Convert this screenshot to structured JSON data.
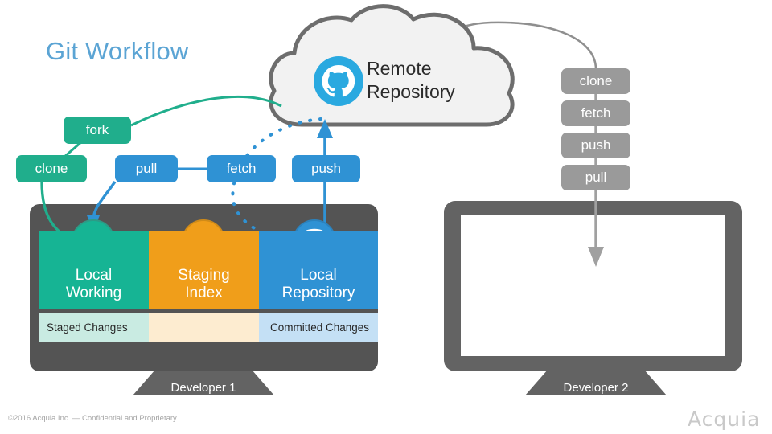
{
  "page": {
    "title": "Git Workflow",
    "footer_text": "©2016 Acquia Inc. — Confidential and Proprietary",
    "logo_text": "Acquia",
    "title_color": "#5ba4d4"
  },
  "cloud": {
    "label_line1": "Remote",
    "label_line2": "Repository",
    "label": "Remote\nRepository",
    "icon": "github-octocat-icon",
    "icon_color": "#2aa9e0",
    "fill": "#f2f2f2",
    "stroke": "#6d6d6d"
  },
  "left_commands": [
    {
      "label": "fork",
      "color": "#20ae8c",
      "style": "green"
    },
    {
      "label": "clone",
      "color": "#20ae8c",
      "style": "green"
    },
    {
      "label": "pull",
      "color": "#2f92d4",
      "style": "blue"
    },
    {
      "label": "fetch",
      "color": "#2f92d4",
      "style": "blue"
    },
    {
      "label": "push",
      "color": "#2f92d4",
      "style": "blue"
    }
  ],
  "right_commands": [
    {
      "label": "clone",
      "color": "#9a9a9a"
    },
    {
      "label": "fetch",
      "color": "#9a9a9a"
    },
    {
      "label": "push",
      "color": "#9a9a9a"
    },
    {
      "label": "pull",
      "color": "#9a9a9a"
    }
  ],
  "developer1": {
    "label": "Developer 1",
    "columns": [
      {
        "line1": "Local",
        "line2": "Working",
        "name": "local-working",
        "color": "#16b494",
        "icon": "document-icon",
        "icon_bg": "#16b494"
      },
      {
        "line1": "Staging",
        "line2": "Index",
        "name": "staging-index",
        "color": "#f09e1a",
        "icon": "document-check-icon",
        "icon_bg": "#f09e1a"
      },
      {
        "line1": "Local",
        "line2": "Repository",
        "name": "local-repository",
        "color": "#2f92d4",
        "icon": "database-icon",
        "icon_bg": "#2f92d4"
      }
    ],
    "change_bar": [
      {
        "label": "Staged Changes",
        "color": "#c9ebe2"
      },
      {
        "label": "",
        "color": "#fdecd0"
      },
      {
        "label": "Committed Changes",
        "color": "#c4e0f5"
      }
    ]
  },
  "developer2": {
    "label": "Developer 2",
    "screen_color": "#ffffff",
    "bezel_color": "#636363"
  },
  "arrows": {
    "fork_from_cloud": "green",
    "clone_to_local_working": "green",
    "pull_to_local_working": "blue",
    "push_to_cloud": "blue",
    "fetch_from_cloud_dotted": "blue",
    "clone_to_cloud_gray": "gray",
    "gray_down_to_developer2": "gray"
  }
}
